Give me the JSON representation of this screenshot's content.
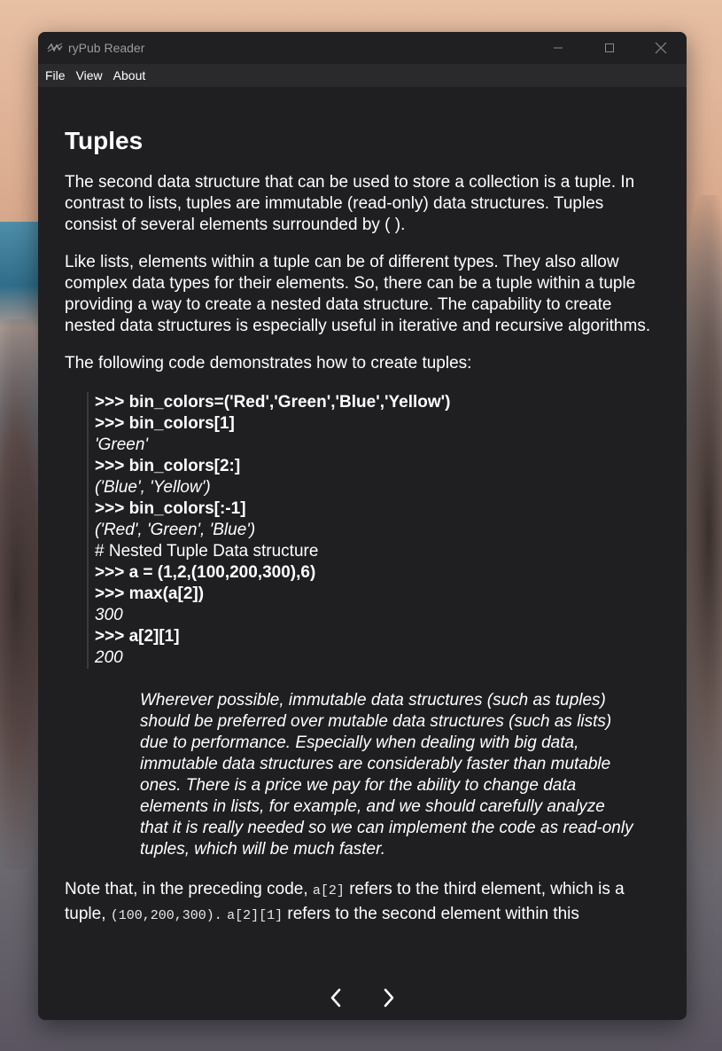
{
  "window": {
    "title": "ryPub Reader",
    "controls": [
      "minimize-icon",
      "maximize-icon",
      "close-icon"
    ]
  },
  "menu": [
    "File",
    "View",
    "About"
  ],
  "article": {
    "heading": "Tuples",
    "paragraphs": [
      "The second data structure that can be used to store a collection is a tuple. In contrast to lists, tuples are immutable (read-only) data structures. Tuples consist of several elements surrounded by ( ).",
      "Like lists, elements within a tuple can be of different types. They also allow complex data types for their elements. So, there can be a tuple within a tuple providing a way to create a nested data structure. The capability to create nested data structures is especially useful in iterative and recursive algorithms.",
      "The following code demonstrates how to create tuples:"
    ],
    "code_lines": [
      ">>> bin_colors=('Red','Green','Blue','Yellow')",
      ">>> bin_colors[1]",
      "'Green'",
      ">>> bin_colors[2:]",
      "('Blue', 'Yellow')",
      ">>> bin_colors[:-1]",
      "('Red', 'Green', 'Blue')",
      "# Nested Tuple Data structure",
      ">>> a = (1,2,(100,200,300),6)",
      ">>> max(a[2])",
      "300",
      ">>> a[2][1]",
      "200"
    ],
    "note": "Wherever possible, immutable data structures (such as tuples) should be preferred over mutable data structures (such as lists) due to performance. Especially when dealing with big data, immutable data structures are considerably faster than mutable ones. There is a price we pay for the ability to change data elements in lists, for example, and we should carefully analyze that it is really needed so we can implement the code as read-only tuples, which will be much faster.",
    "last": {
      "t1": "Note that, in the preceding code, ",
      "c1": "a[2]",
      "t2": " refers to the third element, which is a tuple, ",
      "c2": "(100,200,300).",
      "t3": " ",
      "c3": "a[2][1]",
      "t4": " refers to the second element within this"
    }
  },
  "nav": {
    "prev_icon": "chevron-left-icon",
    "next_icon": "chevron-right-icon"
  }
}
